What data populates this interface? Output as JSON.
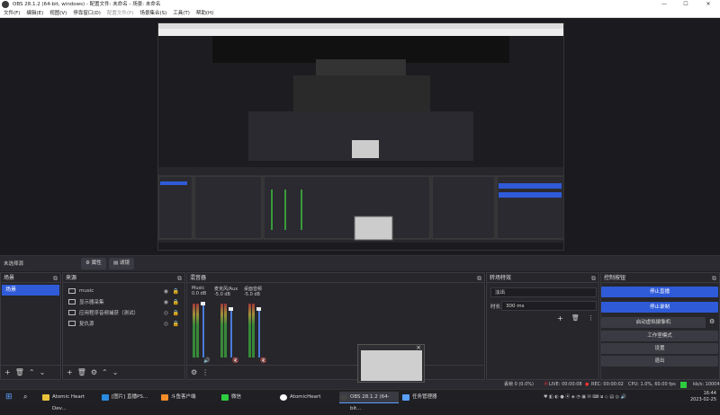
{
  "window": {
    "title": "OBS 28.1.2 (64-bit, windows) - 配置文件: 未命名 - 场景: 未命名"
  },
  "menu": [
    "文件(F)",
    "编辑(E)",
    "视图(V)",
    "停靠窗口(D)",
    "配置文件(P)",
    "场景集合(S)",
    "工具(T)",
    "帮助(H)"
  ],
  "scenebar": {
    "label": "未选择源",
    "props": "属性",
    "filters": "滤镜"
  },
  "docks": {
    "scenes": {
      "title": "场景",
      "items": [
        "场景"
      ]
    },
    "sources": {
      "title": "来源",
      "items": [
        {
          "icon": "image-icon",
          "label": "music"
        },
        {
          "icon": "monitor-icon",
          "label": "显示器采集"
        },
        {
          "icon": "window-icon",
          "label": "应用程序音频捕获（测试）"
        },
        {
          "icon": "link-icon",
          "label": "复仇源"
        }
      ]
    },
    "mixer": {
      "title": "混音器",
      "channels": [
        {
          "name": "Music",
          "db": "0.0 dB"
        },
        {
          "name": "麦克风/Aux",
          "db": "-5.0 dB"
        },
        {
          "name": "桌面音频",
          "db": "-5.0 dB"
        }
      ]
    },
    "transitions": {
      "title": "转场特效",
      "type": "淡出",
      "duration_label": "时长",
      "duration": "300 ms"
    },
    "controls": {
      "title": "控制按钮",
      "buttons": [
        "停止直播",
        "停止录制",
        "启动虚拟摄像机",
        "工作室模式",
        "设置",
        "退出"
      ]
    }
  },
  "status": {
    "dropped": "丢帧 0 (0.0%)",
    "live": "LIVE: 00:00:08",
    "rec": "REC: 00:00:02",
    "cpu": "CPU: 1.0%, 60.00 fps",
    "kbps": "kb/s: 10004"
  },
  "taskbar": {
    "items": [
      "Atomic Heart Dev...",
      "[图片] 直播PS...",
      "斗鱼客户端",
      "微信",
      "AtomicHeart",
      "OBS 28.1.2 (64-bit...",
      "任务管理器"
    ],
    "time": "16:44",
    "date": "2023-02-25"
  },
  "colors": {
    "accent": "#2f5bd8",
    "panel": "#26262b",
    "bg": "#1f1f23"
  }
}
